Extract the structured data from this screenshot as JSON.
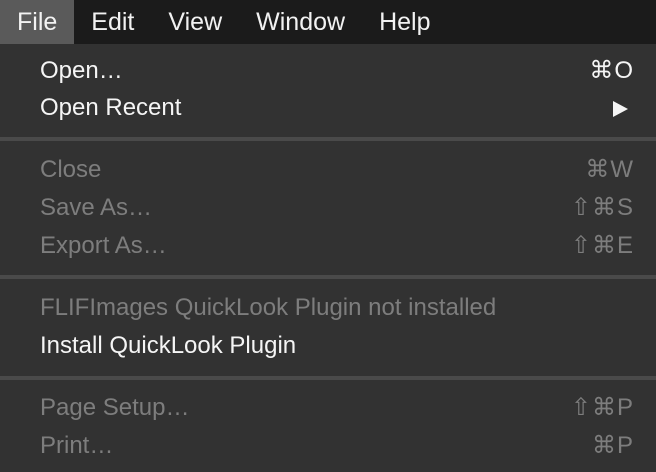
{
  "menubar": {
    "items": [
      {
        "label": "File"
      },
      {
        "label": "Edit"
      },
      {
        "label": "View"
      },
      {
        "label": "Window"
      },
      {
        "label": "Help"
      }
    ]
  },
  "file_menu": {
    "open": {
      "label": "Open…",
      "shortcut": "⌘O"
    },
    "open_recent": {
      "label": "Open Recent"
    },
    "close": {
      "label": "Close",
      "shortcut": "⌘W"
    },
    "save_as": {
      "label": "Save As…",
      "shortcut": "⇧⌘S"
    },
    "export_as": {
      "label": "Export As…",
      "shortcut": "⇧⌘E"
    },
    "plugin_status": {
      "label": "FLIFImages QuickLook Plugin not installed"
    },
    "install_plugin": {
      "label": "Install QuickLook Plugin"
    },
    "page_setup": {
      "label": "Page Setup…",
      "shortcut": "⇧⌘P"
    },
    "print": {
      "label": "Print…",
      "shortcut": "⌘P"
    }
  },
  "colors": {
    "menubar_bg": "#1b1b1b",
    "active_menubar_item_bg": "#5a5a5a",
    "menu_bg": "#323232",
    "enabled_text": "#f5f5f5",
    "disabled_text": "#7d7d7d",
    "separator": "#4a4a4a"
  },
  "icons": {
    "submenu": "submenu-arrow-icon"
  }
}
